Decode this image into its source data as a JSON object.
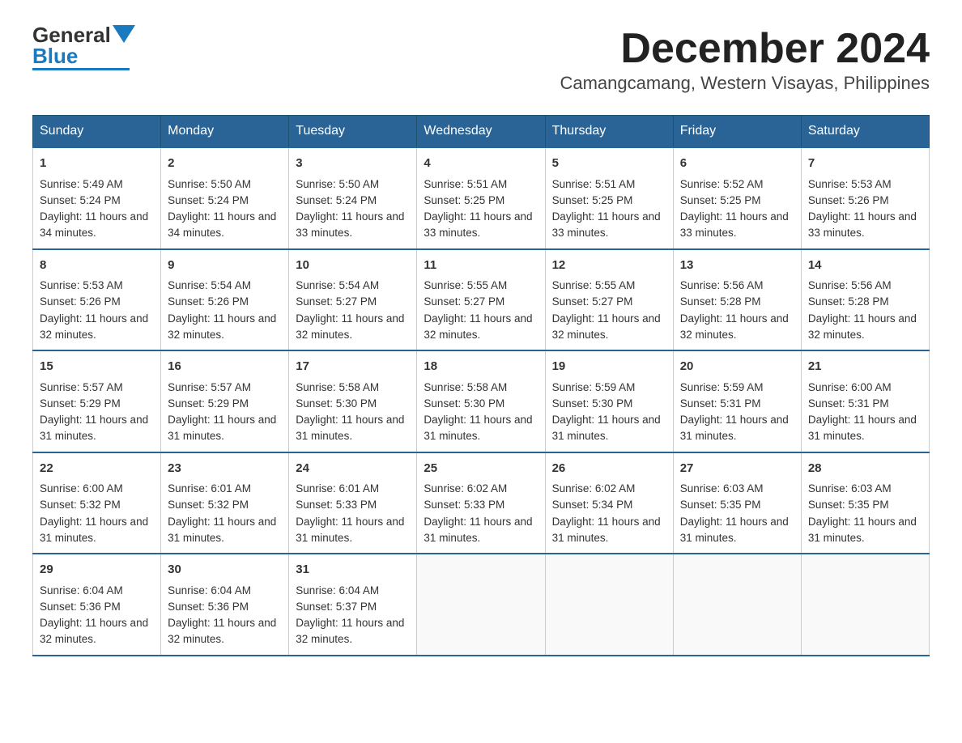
{
  "logo": {
    "general": "General",
    "blue": "Blue"
  },
  "title": "December 2024",
  "subtitle": "Camangcamang, Western Visayas, Philippines",
  "days_of_week": [
    "Sunday",
    "Monday",
    "Tuesday",
    "Wednesday",
    "Thursday",
    "Friday",
    "Saturday"
  ],
  "weeks": [
    [
      {
        "day": "1",
        "sunrise": "5:49 AM",
        "sunset": "5:24 PM",
        "daylight": "11 hours and 34 minutes."
      },
      {
        "day": "2",
        "sunrise": "5:50 AM",
        "sunset": "5:24 PM",
        "daylight": "11 hours and 34 minutes."
      },
      {
        "day": "3",
        "sunrise": "5:50 AM",
        "sunset": "5:24 PM",
        "daylight": "11 hours and 33 minutes."
      },
      {
        "day": "4",
        "sunrise": "5:51 AM",
        "sunset": "5:25 PM",
        "daylight": "11 hours and 33 minutes."
      },
      {
        "day": "5",
        "sunrise": "5:51 AM",
        "sunset": "5:25 PM",
        "daylight": "11 hours and 33 minutes."
      },
      {
        "day": "6",
        "sunrise": "5:52 AM",
        "sunset": "5:25 PM",
        "daylight": "11 hours and 33 minutes."
      },
      {
        "day": "7",
        "sunrise": "5:53 AM",
        "sunset": "5:26 PM",
        "daylight": "11 hours and 33 minutes."
      }
    ],
    [
      {
        "day": "8",
        "sunrise": "5:53 AM",
        "sunset": "5:26 PM",
        "daylight": "11 hours and 32 minutes."
      },
      {
        "day": "9",
        "sunrise": "5:54 AM",
        "sunset": "5:26 PM",
        "daylight": "11 hours and 32 minutes."
      },
      {
        "day": "10",
        "sunrise": "5:54 AM",
        "sunset": "5:27 PM",
        "daylight": "11 hours and 32 minutes."
      },
      {
        "day": "11",
        "sunrise": "5:55 AM",
        "sunset": "5:27 PM",
        "daylight": "11 hours and 32 minutes."
      },
      {
        "day": "12",
        "sunrise": "5:55 AM",
        "sunset": "5:27 PM",
        "daylight": "11 hours and 32 minutes."
      },
      {
        "day": "13",
        "sunrise": "5:56 AM",
        "sunset": "5:28 PM",
        "daylight": "11 hours and 32 minutes."
      },
      {
        "day": "14",
        "sunrise": "5:56 AM",
        "sunset": "5:28 PM",
        "daylight": "11 hours and 32 minutes."
      }
    ],
    [
      {
        "day": "15",
        "sunrise": "5:57 AM",
        "sunset": "5:29 PM",
        "daylight": "11 hours and 31 minutes."
      },
      {
        "day": "16",
        "sunrise": "5:57 AM",
        "sunset": "5:29 PM",
        "daylight": "11 hours and 31 minutes."
      },
      {
        "day": "17",
        "sunrise": "5:58 AM",
        "sunset": "5:30 PM",
        "daylight": "11 hours and 31 minutes."
      },
      {
        "day": "18",
        "sunrise": "5:58 AM",
        "sunset": "5:30 PM",
        "daylight": "11 hours and 31 minutes."
      },
      {
        "day": "19",
        "sunrise": "5:59 AM",
        "sunset": "5:30 PM",
        "daylight": "11 hours and 31 minutes."
      },
      {
        "day": "20",
        "sunrise": "5:59 AM",
        "sunset": "5:31 PM",
        "daylight": "11 hours and 31 minutes."
      },
      {
        "day": "21",
        "sunrise": "6:00 AM",
        "sunset": "5:31 PM",
        "daylight": "11 hours and 31 minutes."
      }
    ],
    [
      {
        "day": "22",
        "sunrise": "6:00 AM",
        "sunset": "5:32 PM",
        "daylight": "11 hours and 31 minutes."
      },
      {
        "day": "23",
        "sunrise": "6:01 AM",
        "sunset": "5:32 PM",
        "daylight": "11 hours and 31 minutes."
      },
      {
        "day": "24",
        "sunrise": "6:01 AM",
        "sunset": "5:33 PM",
        "daylight": "11 hours and 31 minutes."
      },
      {
        "day": "25",
        "sunrise": "6:02 AM",
        "sunset": "5:33 PM",
        "daylight": "11 hours and 31 minutes."
      },
      {
        "day": "26",
        "sunrise": "6:02 AM",
        "sunset": "5:34 PM",
        "daylight": "11 hours and 31 minutes."
      },
      {
        "day": "27",
        "sunrise": "6:03 AM",
        "sunset": "5:35 PM",
        "daylight": "11 hours and 31 minutes."
      },
      {
        "day": "28",
        "sunrise": "6:03 AM",
        "sunset": "5:35 PM",
        "daylight": "11 hours and 31 minutes."
      }
    ],
    [
      {
        "day": "29",
        "sunrise": "6:04 AM",
        "sunset": "5:36 PM",
        "daylight": "11 hours and 32 minutes."
      },
      {
        "day": "30",
        "sunrise": "6:04 AM",
        "sunset": "5:36 PM",
        "daylight": "11 hours and 32 minutes."
      },
      {
        "day": "31",
        "sunrise": "6:04 AM",
        "sunset": "5:37 PM",
        "daylight": "11 hours and 32 minutes."
      },
      null,
      null,
      null,
      null
    ]
  ],
  "labels": {
    "sunrise": "Sunrise:",
    "sunset": "Sunset:",
    "daylight": "Daylight:"
  }
}
